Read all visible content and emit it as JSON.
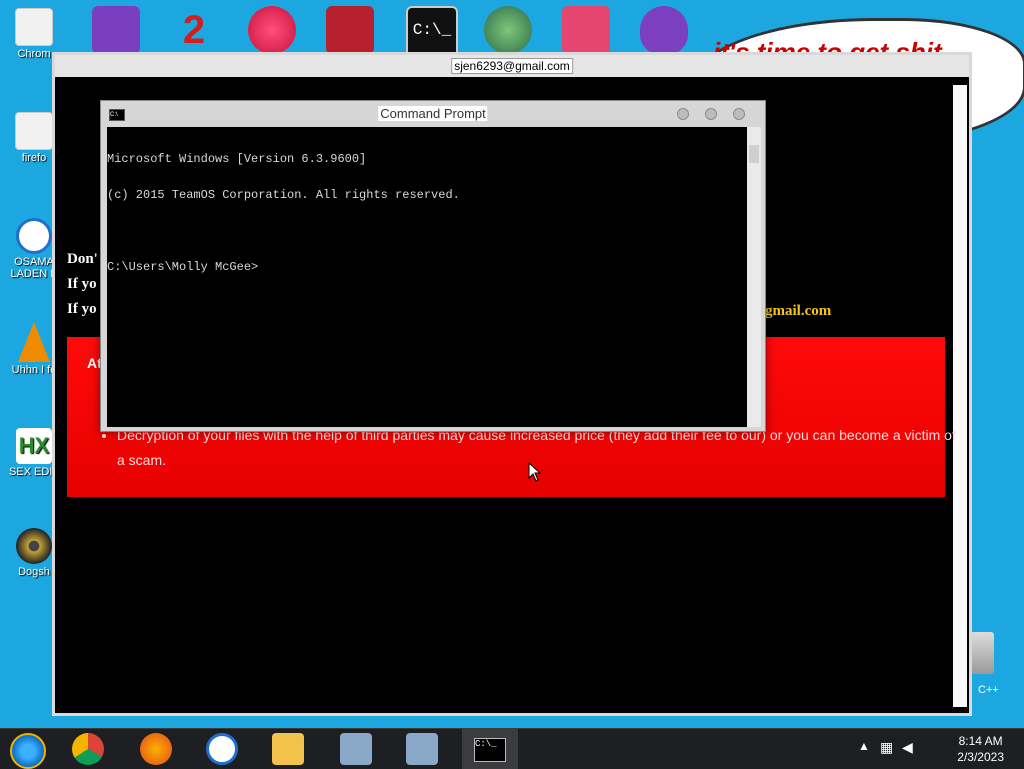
{
  "desktop": {
    "icons_left": [
      {
        "name": "chrome-shortcut-icon",
        "label": "Chrom",
        "color": "#f1f1f1"
      },
      {
        "name": "firefox-shortcut-icon",
        "label": "firefo",
        "color": "#f1f1f1"
      },
      {
        "name": "osama-icon",
        "label": "OSAMA\nLADEN E",
        "color": "#1f6fd1"
      },
      {
        "name": "vlc-icon",
        "label": "Uhhn I fo",
        "color": "#f08a00"
      },
      {
        "name": "hex-editor-icon",
        "label": "SEX EDIT",
        "color": "#ffffff"
      },
      {
        "name": "disc-icon",
        "label": "Dogsh",
        "color": "#c9a23a"
      }
    ],
    "recycle_label": "C++",
    "speech_bubble": "it's time to get shit"
  },
  "ransom_window": {
    "title": "sjen6293@gmail.com",
    "lines": [
      "Don'",
      "If yo",
      "If yo"
    ],
    "email_fragment": "gmail.com",
    "red_box_heading": "At",
    "bullet": "Decryption of your files with the help of third parties may cause increased price (they add their fee to our) or you can become a victim of a scam."
  },
  "cmd": {
    "title": "Command Prompt",
    "lines": [
      "Microsoft Windows [Version 6.3.9600]",
      "(c) 2015 TeamOS Corporation. All rights reserved.",
      "",
      "C:\\Users\\Molly McGee>"
    ]
  },
  "taskbar": {
    "clock_time": "8:14 AM",
    "clock_date": "2/3/2023"
  }
}
